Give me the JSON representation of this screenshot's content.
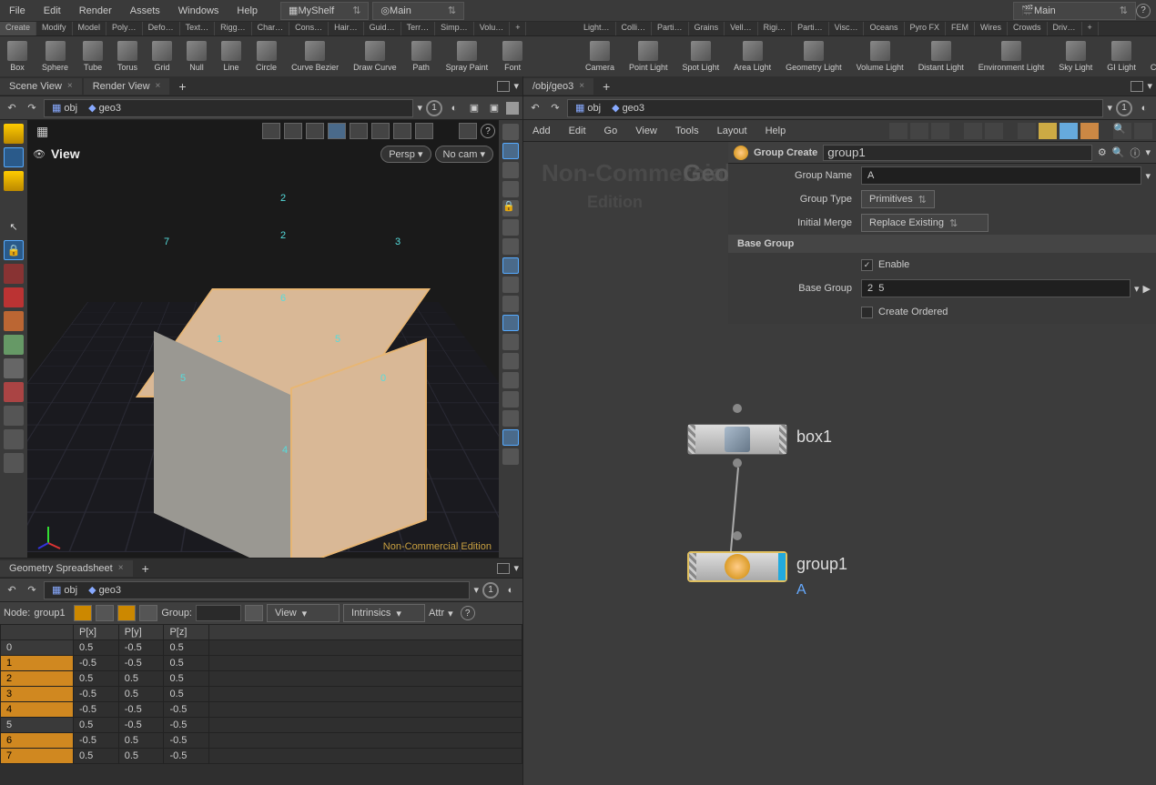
{
  "menubar": [
    "File",
    "Edit",
    "Render",
    "Assets",
    "Windows",
    "Help"
  ],
  "shelves": {
    "myshelf": "MyShelf",
    "main": "Main",
    "main2": "Main"
  },
  "shelf_left": {
    "tabs": [
      "Create",
      "Modify",
      "Model",
      "Poly…",
      "Defo…",
      "Text…",
      "Rigg…",
      "Char…",
      "Cons…",
      "Hair…",
      "Guid…",
      "Terr…",
      "Simp…",
      "Volu…",
      "+"
    ],
    "active_tab": 0,
    "tools": [
      "Box",
      "Sphere",
      "Tube",
      "Torus",
      "Grid",
      "Null",
      "Line",
      "Circle",
      "Curve Bezier",
      "Draw Curve",
      "Path",
      "Spray Paint",
      "Font"
    ]
  },
  "shelf_right": {
    "tabs": [
      "Light…",
      "Colli…",
      "Parti…",
      "Grains",
      "Vell…",
      "Rigi…",
      "Parti…",
      "Visc…",
      "Oceans",
      "Pyro FX",
      "FEM",
      "Wires",
      "Crowds",
      "Driv…",
      "+"
    ],
    "tools": [
      "Camera",
      "Point Light",
      "Spot Light",
      "Area Light",
      "Geometry Light",
      "Volume Light",
      "Distant Light",
      "Environment Light",
      "Sky Light",
      "GI Light",
      "Caustic Light"
    ]
  },
  "left_tabs": {
    "scene": "Scene View",
    "render": "Render View"
  },
  "path": {
    "obj": "obj",
    "geo": "geo3",
    "counter": "1"
  },
  "viewport": {
    "label": "View",
    "persp": "Persp",
    "nocam": "No cam",
    "verts": {
      "v0": "0",
      "v1": "1",
      "v2": "2",
      "v2b": "2",
      "v3": "3",
      "v4": "4",
      "v5": "5",
      "v5b": "5",
      "v6": "6",
      "v7": "7"
    },
    "watermark": "Non-Commercial Edition"
  },
  "ss": {
    "tab": "Geometry Spreadsheet",
    "node_label": "Node:",
    "node_val": "group1",
    "group_label": "Group:",
    "view_label": "View",
    "intr_label": "Intrinsics",
    "attr_label": "Attr",
    "cols": [
      "",
      "P[x]",
      "P[y]",
      "P[z]"
    ],
    "rows": [
      {
        "i": "0",
        "sel": false,
        "v": [
          "0.5",
          "-0.5",
          "0.5"
        ]
      },
      {
        "i": "1",
        "sel": true,
        "v": [
          "-0.5",
          "-0.5",
          "0.5"
        ]
      },
      {
        "i": "2",
        "sel": true,
        "v": [
          "0.5",
          "0.5",
          "0.5"
        ]
      },
      {
        "i": "3",
        "sel": true,
        "v": [
          "-0.5",
          "0.5",
          "0.5"
        ]
      },
      {
        "i": "4",
        "sel": true,
        "v": [
          "-0.5",
          "-0.5",
          "-0.5"
        ]
      },
      {
        "i": "5",
        "sel": false,
        "v": [
          "0.5",
          "-0.5",
          "-0.5"
        ]
      },
      {
        "i": "6",
        "sel": true,
        "v": [
          "-0.5",
          "0.5",
          "-0.5"
        ]
      },
      {
        "i": "7",
        "sel": true,
        "v": [
          "0.5",
          "0.5",
          "-0.5"
        ]
      }
    ]
  },
  "right_tab": "/obj/geo3",
  "network_menu": [
    "Add",
    "Edit",
    "Go",
    "View",
    "Tools",
    "Layout",
    "Help"
  ],
  "params": {
    "op_type": "Group Create",
    "op_name": "group1",
    "grpname_label": "Group Name",
    "grpname": "A",
    "grptype_label": "Group Type",
    "grptype": "Primitives",
    "merge_label": "Initial Merge",
    "merge": "Replace Existing",
    "section_base": "Base Group",
    "enable_label": "Enable",
    "enable": true,
    "basegrp_label": "Base Group",
    "basegrp": "2  5",
    "ordered_label": "Create Ordered",
    "ordered": false
  },
  "network": {
    "watermark1": "Non-Commercial",
    "watermark2": "Geometry",
    "watermark3": "Edition",
    "box_label": "box1",
    "group_label": "group1",
    "group_sub": "A"
  }
}
